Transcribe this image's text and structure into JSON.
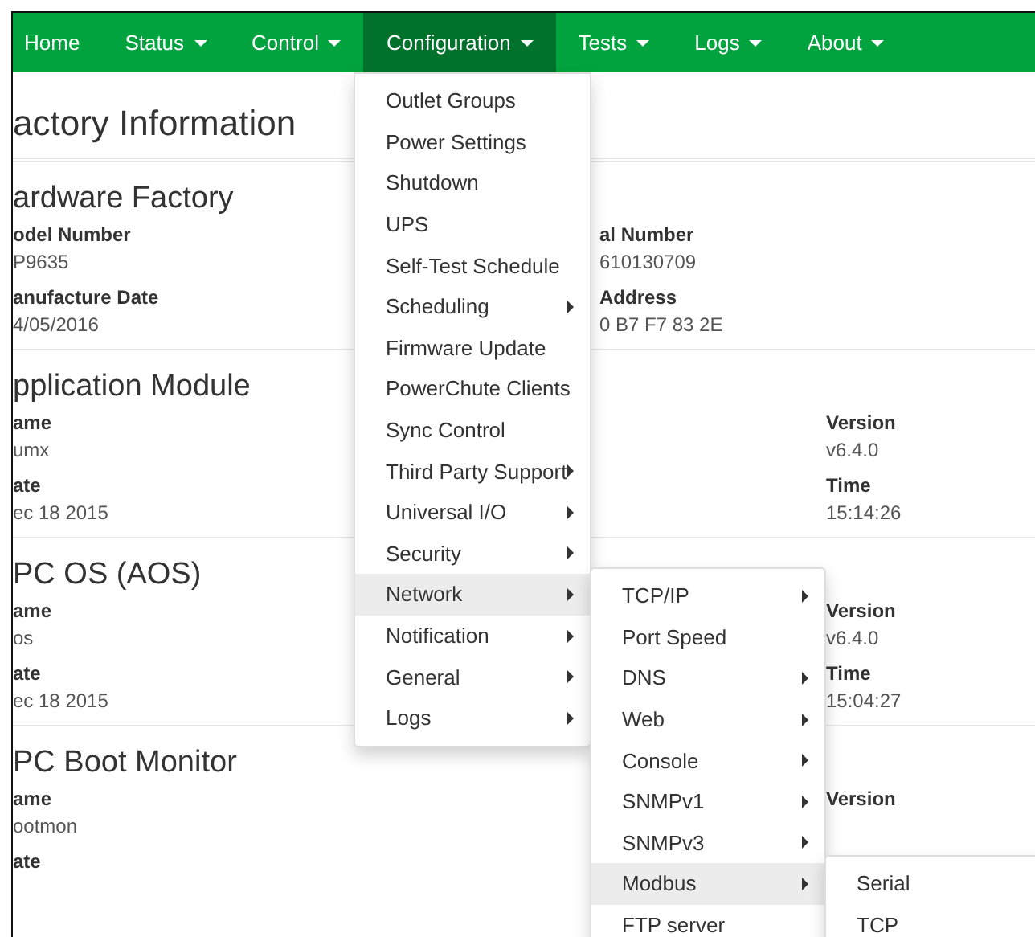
{
  "nav": [
    {
      "label": "Home",
      "has_caret": false,
      "selected": false
    },
    {
      "label": "Status",
      "has_caret": true,
      "selected": false
    },
    {
      "label": "Control",
      "has_caret": true,
      "selected": false
    },
    {
      "label": "Configuration",
      "has_caret": true,
      "selected": true
    },
    {
      "label": "Tests",
      "has_caret": true,
      "selected": false
    },
    {
      "label": "Logs",
      "has_caret": true,
      "selected": false
    },
    {
      "label": "About",
      "has_caret": true,
      "selected": false
    }
  ],
  "page_title": "actory Information",
  "sections": [
    {
      "title": "ardware Factory",
      "left": [
        {
          "label": "odel Number",
          "value": "P9635"
        },
        {
          "label": "anufacture Date",
          "value": "4/05/2016"
        }
      ],
      "middle": [
        {
          "label": "al Number",
          "value": "610130709"
        },
        {
          "label": "Address",
          "value": "0 B7 F7 83 2E"
        }
      ]
    },
    {
      "title": "pplication Module",
      "left": [
        {
          "label": "ame",
          "value": "umx"
        },
        {
          "label": "ate",
          "value": "ec 18 2015"
        }
      ],
      "right": [
        {
          "label": "Version",
          "value": "v6.4.0"
        },
        {
          "label": "Time",
          "value": "15:14:26"
        }
      ]
    },
    {
      "title": "PC OS (AOS)",
      "left": [
        {
          "label": "ame",
          "value": "os"
        },
        {
          "label": "ate",
          "value": "ec 18 2015"
        }
      ],
      "right": [
        {
          "label": "Version",
          "value": "v6.4.0"
        },
        {
          "label": "Time",
          "value": "15:04:27"
        }
      ]
    },
    {
      "title": "PC Boot Monitor",
      "left": [
        {
          "label": "ame",
          "value": "ootmon"
        },
        {
          "label": "ate"
        }
      ],
      "right": [
        {
          "label": "Version"
        }
      ]
    }
  ],
  "configuration_menu": [
    {
      "label": "Outlet Groups",
      "has_submenu": false,
      "selected": false
    },
    {
      "label": "Power Settings",
      "has_submenu": false,
      "selected": false
    },
    {
      "label": "Shutdown",
      "has_submenu": false,
      "selected": false
    },
    {
      "label": "UPS",
      "has_submenu": false,
      "selected": false
    },
    {
      "label": "Self-Test Schedule",
      "has_submenu": false,
      "selected": false
    },
    {
      "label": "Scheduling",
      "has_submenu": true,
      "selected": false
    },
    {
      "label": "Firmware Update",
      "has_submenu": false,
      "selected": false
    },
    {
      "label": "PowerChute Clients",
      "has_submenu": false,
      "selected": false
    },
    {
      "label": "Sync Control",
      "has_submenu": false,
      "selected": false
    },
    {
      "label": "Third Party Support",
      "has_submenu": true,
      "selected": false
    },
    {
      "label": "Universal I/O",
      "has_submenu": true,
      "selected": false
    },
    {
      "label": "Security",
      "has_submenu": true,
      "selected": false
    },
    {
      "label": "Network",
      "has_submenu": true,
      "selected": true
    },
    {
      "label": "Notification",
      "has_submenu": true,
      "selected": false
    },
    {
      "label": "General",
      "has_submenu": true,
      "selected": false
    },
    {
      "label": "Logs",
      "has_submenu": true,
      "selected": false
    }
  ],
  "network_menu": [
    {
      "label": "TCP/IP",
      "has_submenu": true,
      "selected": false
    },
    {
      "label": "Port Speed",
      "has_submenu": false,
      "selected": false
    },
    {
      "label": "DNS",
      "has_submenu": true,
      "selected": false
    },
    {
      "label": "Web",
      "has_submenu": true,
      "selected": false
    },
    {
      "label": "Console",
      "has_submenu": true,
      "selected": false
    },
    {
      "label": "SNMPv1",
      "has_submenu": true,
      "selected": false
    },
    {
      "label": "SNMPv3",
      "has_submenu": true,
      "selected": false
    },
    {
      "label": "Modbus",
      "has_submenu": true,
      "selected": true
    },
    {
      "label": "FTP server",
      "has_submenu": false,
      "selected": false
    }
  ],
  "modbus_menu": [
    {
      "label": "Serial",
      "has_submenu": false,
      "selected": false
    },
    {
      "label": "TCP",
      "has_submenu": false,
      "selected": false
    }
  ]
}
